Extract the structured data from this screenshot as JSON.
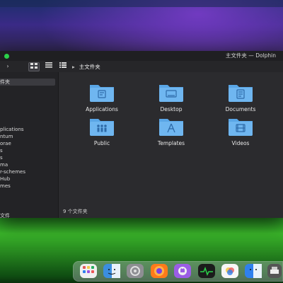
{
  "window": {
    "title": "主文件夹 — Dolphin"
  },
  "toolbar": {
    "back_icon": "chevron-right-icon",
    "view_icons": [
      "grid-view-icon",
      "compact-view-icon",
      "details-view-icon",
      "tree-view-icon"
    ],
    "breadcrumb_sep": "▸",
    "breadcrumb": "主文件夹"
  },
  "sidebar": {
    "items": [
      {
        "label": "",
        "active": false
      },
      {
        "label": "件夹",
        "active": true
      },
      {
        "label": "",
        "active": false
      },
      {
        "label": "",
        "active": false
      },
      {
        "label": "",
        "active": false
      },
      {
        "label": "",
        "active": false
      },
      {
        "label": "plications",
        "active": false
      },
      {
        "label": "ntum",
        "active": false
      },
      {
        "label": "orae",
        "active": false
      },
      {
        "label": "s",
        "active": false
      },
      {
        "label": "s",
        "active": false
      },
      {
        "label": "ma",
        "active": false
      },
      {
        "label": "r-schemes",
        "active": false
      },
      {
        "label": "Hub",
        "active": false
      },
      {
        "label": "mes",
        "active": false
      },
      {
        "label": "",
        "active": false
      },
      {
        "label": "",
        "active": false
      },
      {
        "label": "",
        "active": false
      },
      {
        "label": "文件",
        "active": false
      }
    ]
  },
  "folders": [
    {
      "label": "Applications",
      "emblem": "app-emblem-icon"
    },
    {
      "label": "Desktop",
      "emblem": "desktop-emblem-icon"
    },
    {
      "label": "Documents",
      "emblem": "document-emblem-icon"
    },
    {
      "label": "Public",
      "emblem": "people-emblem-icon"
    },
    {
      "label": "Templates",
      "emblem": "compass-emblem-icon"
    },
    {
      "label": "Videos",
      "emblem": "film-emblem-icon"
    }
  ],
  "status": {
    "text": "9 个文件夹"
  },
  "dock": {
    "items": [
      {
        "name": "launchpad",
        "color": "#e05a5a"
      },
      {
        "name": "finder",
        "color": "#3b8ee0"
      },
      {
        "name": "system-settings",
        "color": "#8e8e93"
      },
      {
        "name": "firefox",
        "color": "#ff7a1a"
      },
      {
        "name": "github",
        "color": "#9b5de5"
      },
      {
        "name": "activity-monitor",
        "color": "#1b1b1b"
      },
      {
        "name": "photos",
        "color": "#f2c94c"
      },
      {
        "name": "finder-2",
        "color": "#2f80ed"
      },
      {
        "name": "printer",
        "color": "#555555"
      }
    ]
  },
  "colors": {
    "folder": "#6fb6f0",
    "folder_tab": "#5aa6e6",
    "accent": "#2bd14a"
  }
}
